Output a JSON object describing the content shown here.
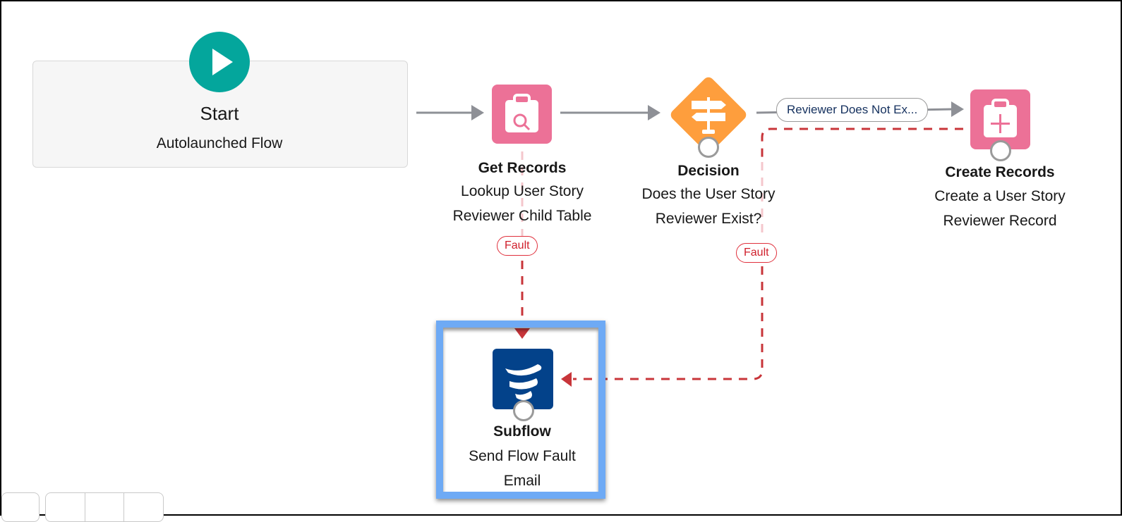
{
  "canvas": {
    "start": {
      "title": "Start",
      "subtitle": "Autolaunched Flow",
      "icon": "play-icon",
      "color": "#04a69c"
    },
    "get_records": {
      "type": "Get Records",
      "label_line1": "Lookup User Story",
      "label_line2": "Reviewer Child Table",
      "icon": "clipboard-search-icon",
      "color": "#ec7197"
    },
    "decision": {
      "type": "Decision",
      "label_line1": "Does the User Story",
      "label_line2": "Reviewer Exist?",
      "icon": "signpost-icon",
      "color": "#fe9e3d"
    },
    "create_records": {
      "type": "Create Records",
      "label_line1": "Create a User Story",
      "label_line2": "Reviewer Record",
      "icon": "clipboard-plus-icon",
      "color": "#ec7197"
    },
    "subflow": {
      "type": "Subflow",
      "label_line1": "Send Flow Fault",
      "label_line2": "Email",
      "icon": "flow-icon",
      "color": "#03428a",
      "selected": true
    },
    "outcome_label": "Reviewer Does Not Ex...",
    "fault_label_1": "Fault",
    "fault_label_2": "Fault"
  },
  "colors": {
    "connector": "#8e9096",
    "fault_connector": "#c8353a",
    "selection": "#6eaaf5"
  }
}
